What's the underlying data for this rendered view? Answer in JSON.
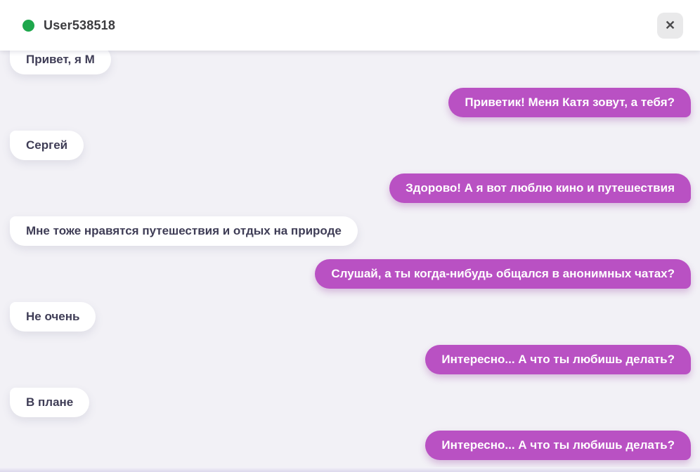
{
  "header": {
    "title": "User538518",
    "online": true,
    "close_icon": "✕"
  },
  "theme": {
    "chat_background": "#f2f1f6",
    "header_background": "#ffffff",
    "online_green": "#1ea74c",
    "outgoing_bubble": "#b951c3",
    "outgoing_text": "#ffffff",
    "incoming_bubble": "#ffffff",
    "incoming_text": "#3f3d56"
  },
  "messages": [
    {
      "side": "in",
      "text": "Привет, я М"
    },
    {
      "side": "out",
      "text": "Приветик! Меня Катя зовут, а тебя?"
    },
    {
      "side": "in",
      "text": "Сергей"
    },
    {
      "side": "out",
      "text": "Здорово! А я вот люблю кино и путешествия"
    },
    {
      "side": "in",
      "text": "Мне тоже нравятся путешествия и отдых на природе"
    },
    {
      "side": "out",
      "text": "Слушай, а ты когда-нибудь общался в анонимных чатах?"
    },
    {
      "side": "in",
      "text": "Не очень"
    },
    {
      "side": "out",
      "text": "Интересно... А что ты любишь делать?"
    },
    {
      "side": "in",
      "text": "В плане"
    },
    {
      "side": "out",
      "text": "Интересно... А что ты любишь делать?"
    }
  ]
}
